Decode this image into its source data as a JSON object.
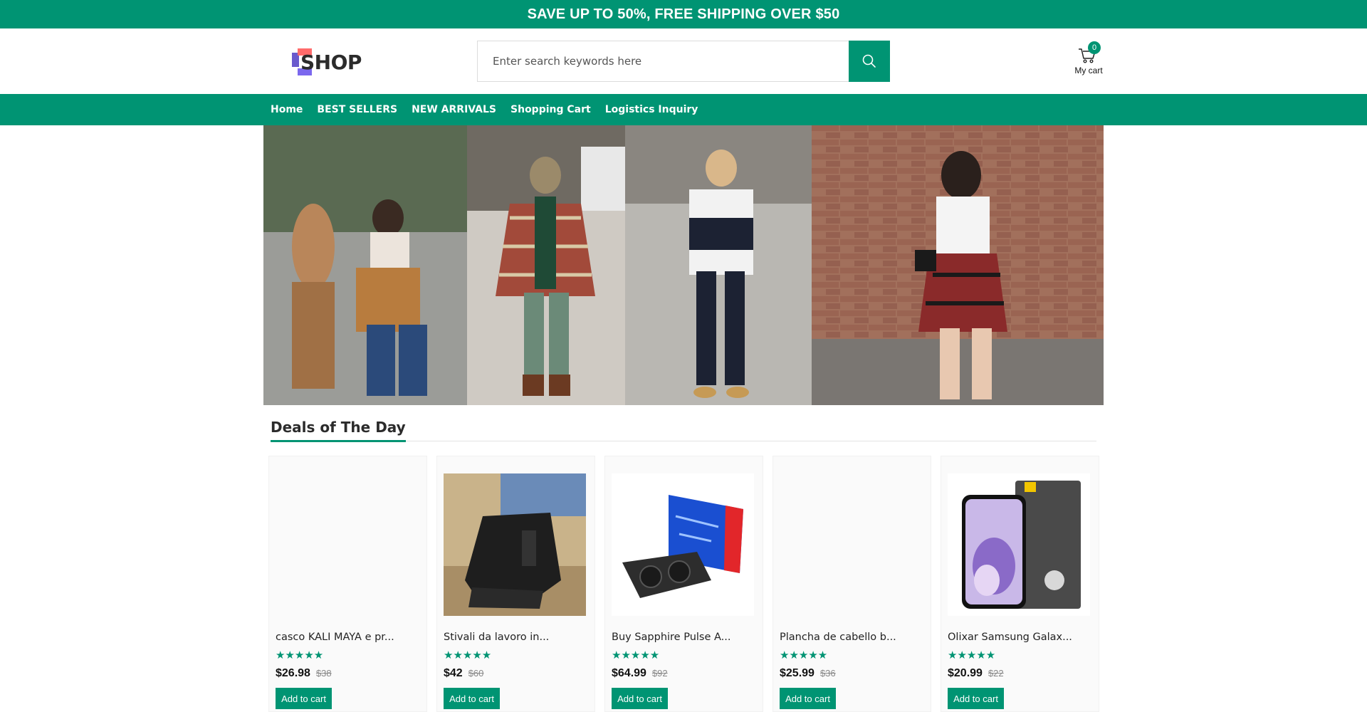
{
  "promo": {
    "text": "SAVE UP TO 50%, FREE SHIPPING OVER $50"
  },
  "header": {
    "logo_text": "SHOP",
    "search_placeholder": "Enter search keywords here",
    "cart_count": "0",
    "cart_label": "My cart"
  },
  "nav": {
    "items": [
      {
        "label": "Home"
      },
      {
        "label": "BEST SELLERS"
      },
      {
        "label": "NEW ARRIVALS"
      },
      {
        "label": "Shopping Cart"
      },
      {
        "label": "Logistics Inquiry"
      }
    ]
  },
  "deals": {
    "title": "Deals of The Day",
    "products": [
      {
        "name": "casco KALI MAYA e pr...",
        "stars": "★★★★★",
        "price": "$26.98",
        "old_price": "$38",
        "button": "Add to cart"
      },
      {
        "name": "Stivali da lavoro in...",
        "stars": "★★★★★",
        "price": "$42",
        "old_price": "$60",
        "button": "Add to cart"
      },
      {
        "name": "Buy Sapphire Pulse A...",
        "stars": "★★★★★",
        "price": "$64.99",
        "old_price": "$92",
        "button": "Add to cart"
      },
      {
        "name": "Plancha de cabello b...",
        "stars": "★★★★★",
        "price": "$25.99",
        "old_price": "$36",
        "button": "Add to cart"
      },
      {
        "name": "Olixar Samsung Galax...",
        "stars": "★★★★★",
        "price": "$20.99",
        "old_price": "$22",
        "button": "Add to cart"
      }
    ]
  },
  "colors": {
    "brand": "#009473",
    "text": "#222222",
    "muted": "#888888"
  },
  "icons": {
    "search": "search-icon",
    "cart": "cart-icon",
    "star": "star-icon"
  }
}
